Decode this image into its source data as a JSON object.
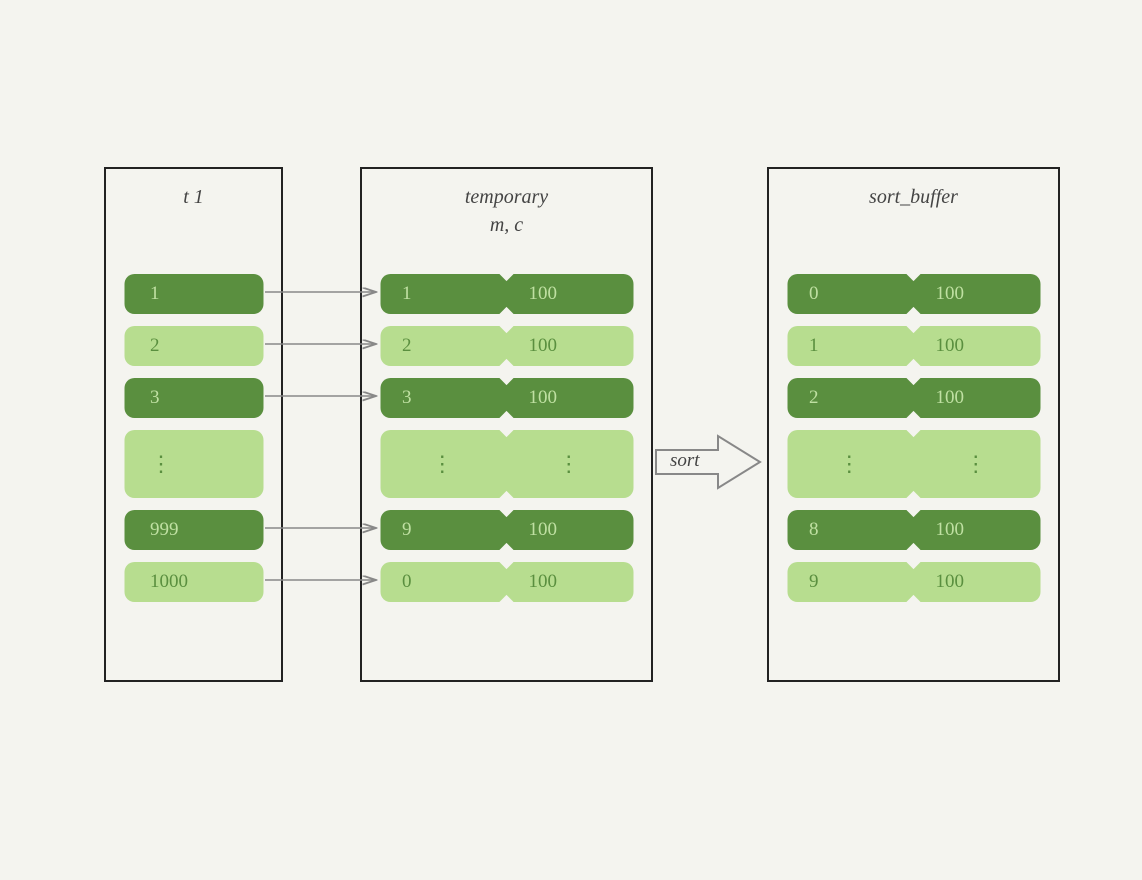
{
  "boxes": {
    "t1": {
      "title": "t 1",
      "rows": [
        {
          "style": "dark",
          "type": "single",
          "cells": [
            "1"
          ]
        },
        {
          "style": "light",
          "type": "single",
          "cells": [
            "2"
          ]
        },
        {
          "style": "dark",
          "type": "single",
          "cells": [
            "3"
          ]
        },
        {
          "style": "light",
          "type": "ellipsis-single",
          "cells": [
            "⋮"
          ]
        },
        {
          "style": "dark",
          "type": "single",
          "cells": [
            "999"
          ]
        },
        {
          "style": "light",
          "type": "single",
          "cells": [
            "1000"
          ]
        }
      ]
    },
    "temporary": {
      "title_line1": "temporary",
      "title_line2": "m, c",
      "rows": [
        {
          "style": "dark",
          "type": "double",
          "cells": [
            "1",
            "100"
          ]
        },
        {
          "style": "light",
          "type": "double",
          "cells": [
            "2",
            "100"
          ]
        },
        {
          "style": "dark",
          "type": "double",
          "cells": [
            "3",
            "100"
          ]
        },
        {
          "style": "light",
          "type": "ellipsis-double",
          "cells": [
            "⋮",
            "⋮"
          ]
        },
        {
          "style": "dark",
          "type": "double",
          "cells": [
            "9",
            "100"
          ]
        },
        {
          "style": "light",
          "type": "double",
          "cells": [
            "0",
            "100"
          ]
        }
      ]
    },
    "sort_buffer": {
      "title": "sort_buffer",
      "rows": [
        {
          "style": "dark",
          "type": "double",
          "cells": [
            "0",
            "100"
          ]
        },
        {
          "style": "light",
          "type": "double",
          "cells": [
            "1",
            "100"
          ]
        },
        {
          "style": "dark",
          "type": "double",
          "cells": [
            "2",
            "100"
          ]
        },
        {
          "style": "light",
          "type": "ellipsis-double",
          "cells": [
            "⋮",
            "⋮"
          ]
        },
        {
          "style": "dark",
          "type": "double",
          "cells": [
            "8",
            "100"
          ]
        },
        {
          "style": "light",
          "type": "double",
          "cells": [
            "9",
            "100"
          ]
        }
      ]
    }
  },
  "sort_label": "sort"
}
